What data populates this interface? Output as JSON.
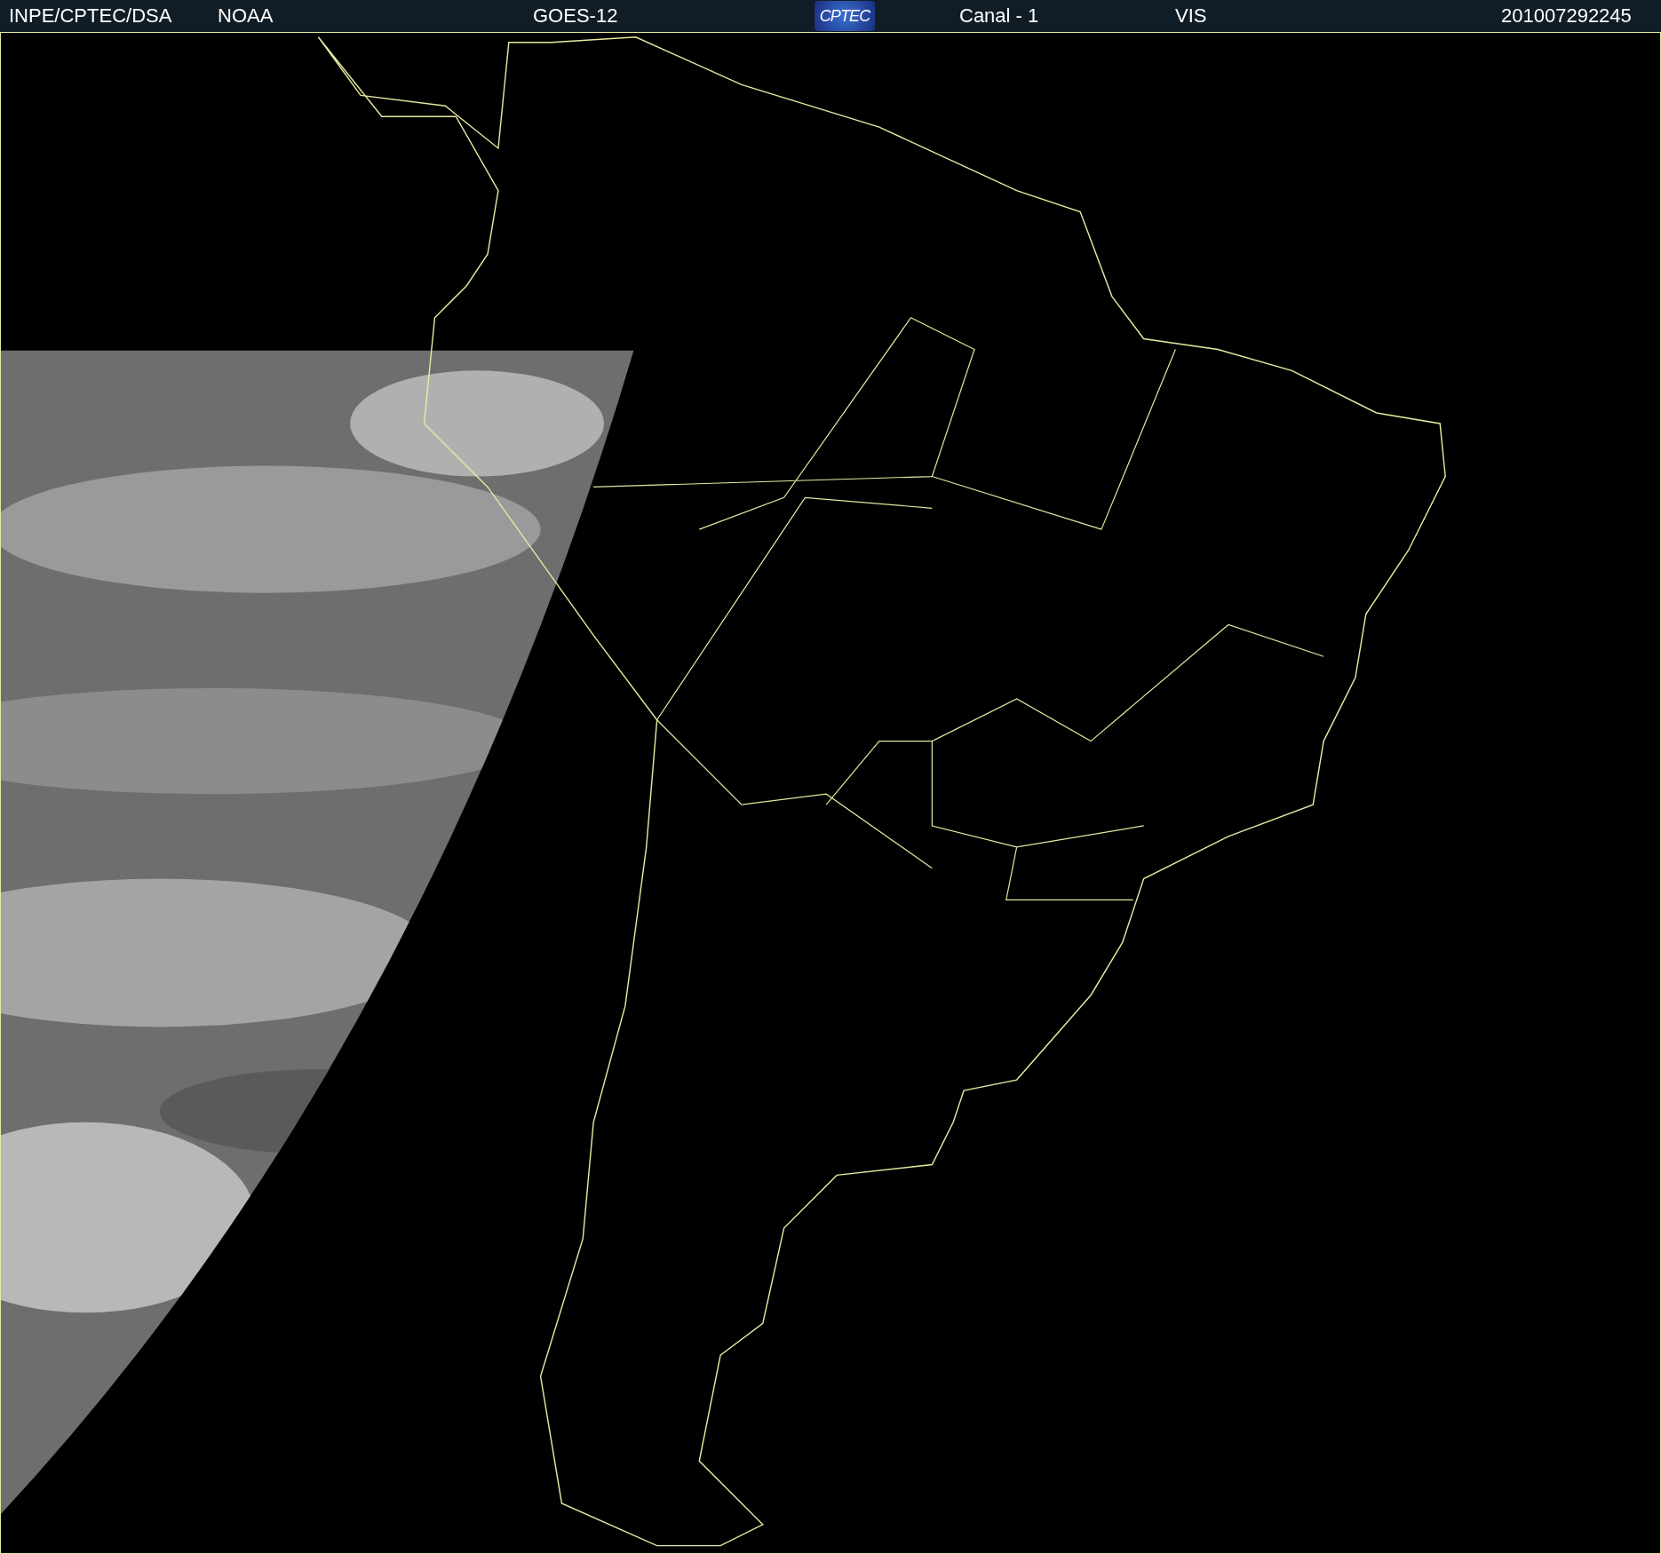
{
  "header": {
    "source": "INPE/CPTEC/DSA",
    "agency": "NOAA",
    "satellite": "GOES-12",
    "logo": "CPTEC",
    "channel": "Canal - 1",
    "band": "VIS",
    "timestamp": "201007292245"
  }
}
